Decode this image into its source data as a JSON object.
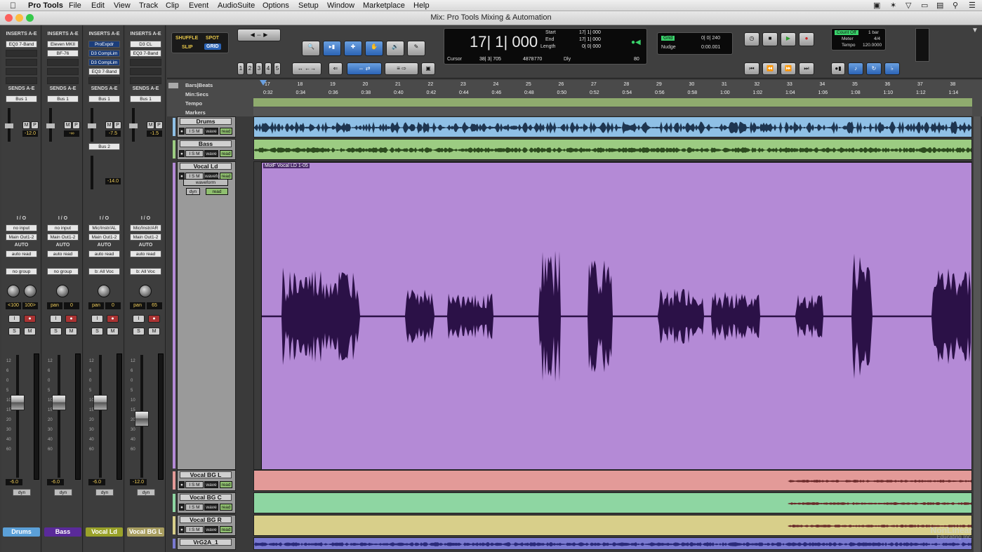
{
  "menubar": {
    "app": "Pro Tools",
    "items": [
      "File",
      "Edit",
      "View",
      "Track",
      "Clip",
      "Event",
      "AudioSuite",
      "Options",
      "Setup",
      "Window",
      "Marketplace",
      "Help"
    ]
  },
  "window": {
    "title": "Mix: Pro Tools Mixing & Automation"
  },
  "mixer": {
    "strips": [
      {
        "name": "Drums",
        "inserts_label": "INSERTS A-E",
        "inserts": [
          "EQ3 7-Band"
        ],
        "sends_label": "SENDS A-E",
        "sends": [
          "Bus 1"
        ],
        "send_level": "-12.0",
        "io_label": "I / O",
        "input": "no input",
        "output": "Main Out1-2",
        "auto_label": "AUTO",
        "auto": "auto read",
        "group": "no group",
        "pan": "<100",
        "pan2": "100>",
        "fader_value": "-6.0",
        "name_color": "#5ba0d8",
        "fader_pos": 0.62,
        "meter_level": 0.0
      },
      {
        "name": "Bass",
        "inserts_label": "INSERTS A-E",
        "inserts": [
          "Eleven MKII",
          "BF-76"
        ],
        "sends_label": "SENDS A-E",
        "sends": [
          "Bus 1"
        ],
        "send_level": "-∞",
        "io_label": "I / O",
        "input": "no input",
        "output": "Main Out1-2",
        "auto_label": "AUTO",
        "auto": "auto read",
        "group": "no group",
        "pan": "pan",
        "pan2": "0",
        "fader_value": "-6.0",
        "name_color": "#5a2a9a",
        "fader_pos": 0.62,
        "meter_level": 0.0
      },
      {
        "name": "Vocal Ld",
        "inserts_label": "INSERTS A-E",
        "inserts": [
          "ProExpdr",
          "D3 CompLim",
          "D3 CompLim",
          "EQ3 7-Band"
        ],
        "sends_label": "SENDS A-E",
        "sends": [
          "Bus 1",
          "Bus 2"
        ],
        "send_level": "-7.5",
        "send_level2": "-14.0",
        "io_label": "I / O",
        "input": "Mic/Instr/AL",
        "output": "Main Out1-2",
        "auto_label": "AUTO",
        "auto": "auto read",
        "group": "b: All Voc",
        "pan": "pan",
        "pan2": "0",
        "fader_value": "-6.0",
        "name_color": "#9aa22a",
        "fader_pos": 0.62,
        "meter_level": 0.0
      },
      {
        "name": "Vocal BG L",
        "inserts_label": "INSERTS A-E",
        "inserts": [
          "D3 CL",
          "EQ3 7-Band"
        ],
        "sends_label": "SENDS A-E",
        "sends": [
          "Bus 1"
        ],
        "send_level": "-1.5",
        "io_label": "I / O",
        "input": "Mic/Instr/AR",
        "output": "Main Out1-2",
        "auto_label": "AUTO",
        "auto": "auto read",
        "group": "b: All Voc",
        "pan": "pan",
        "pan2": "65",
        "fader_value": "-12.0",
        "name_color": "#a89e60",
        "fader_pos": 0.47,
        "meter_level": 0.0
      }
    ],
    "dyn_label": "dyn",
    "scale": [
      "12",
      "6",
      "0",
      "5",
      "10",
      "15",
      "20",
      "30",
      "40",
      "60"
    ]
  },
  "toolbar": {
    "modes": [
      "SHUFFLE",
      "SPOT",
      "SLIP",
      "GRID"
    ],
    "zoom_presets": [
      "1",
      "2",
      "3",
      "4",
      "5"
    ],
    "counter_main": "17| 1| 000",
    "start_label": "Start",
    "end_label": "End",
    "length_label": "Length",
    "start": "17| 1| 000",
    "end": "17| 1| 000",
    "length": "0| 0| 000",
    "cursor_label": "Cursor",
    "cursor": "38| 3| 705",
    "cursor_sample": "4878770",
    "dly_label": "Dly",
    "level": "80",
    "grid_label": "Grid",
    "grid_value": "0| 0| 240",
    "nudge_label": "Nudge",
    "nudge_value": "0:00.001",
    "count_off": "Count Off",
    "count_off_value": "1 bar",
    "meter_label": "Meter",
    "meter_value": "4/4",
    "tempo_label": "Tempo",
    "tempo_value": "120.0000"
  },
  "rulers": {
    "bars_label": "Bars|Beats",
    "minsecs_label": "Min:Secs",
    "tempo_label": "Tempo",
    "markers_label": "Markers",
    "bars": [
      "17",
      "18",
      "19",
      "20",
      "21",
      "22",
      "23",
      "24",
      "25",
      "26",
      "27",
      "28",
      "29",
      "30",
      "31",
      "32",
      "33",
      "34",
      "35",
      "36",
      "37",
      "38"
    ],
    "times": [
      "0:32",
      "0:34",
      "0:36",
      "0:38",
      "0:40",
      "0:42",
      "0:44",
      "0:46",
      "0:48",
      "0:50",
      "0:52",
      "0:54",
      "0:56",
      "0:58",
      "1:00",
      "1:02",
      "1:04",
      "1:06",
      "1:08",
      "1:10",
      "1:12",
      "1:14"
    ]
  },
  "tracks": [
    {
      "name": "Drums",
      "view": "wave",
      "auto": "read",
      "color": "#8fc0e6"
    },
    {
      "name": "Bass",
      "view": "wave",
      "auto": "read",
      "color": "#9ccc82"
    },
    {
      "name": "Vocal Ld",
      "view": "waveform",
      "auto": "read",
      "color": "#b48ad6",
      "clip_name": "MotF Vocal LD 1-05",
      "dyn": "dyn"
    },
    {
      "name": "Vocal BG L",
      "view": "wave",
      "auto": "read",
      "color": "#e39a98"
    },
    {
      "name": "Vocal BG C",
      "view": "wave",
      "auto": "read",
      "color": "#8ed6a2"
    },
    {
      "name": "Vocal BG R",
      "view": "wave",
      "auto": "read",
      "color": "#d8cf8a"
    },
    {
      "name": "VrG2A_1",
      "view": "",
      "auto": "",
      "color": "#7a7ad0"
    }
  ],
  "brand": {
    "line1": "NonLinear",
    "line2": "Educating Inc."
  }
}
